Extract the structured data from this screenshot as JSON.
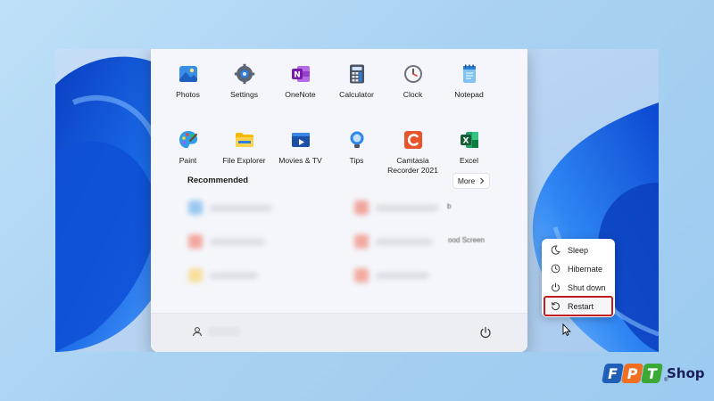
{
  "start_menu": {
    "apps": [
      {
        "label": "Photos",
        "icon": "photos-icon"
      },
      {
        "label": "Settings",
        "icon": "settings-icon"
      },
      {
        "label": "OneNote",
        "icon": "onenote-icon"
      },
      {
        "label": "Calculator",
        "icon": "calculator-icon"
      },
      {
        "label": "Clock",
        "icon": "clock-icon"
      },
      {
        "label": "Notepad",
        "icon": "notepad-icon"
      },
      {
        "label": "Paint",
        "icon": "paint-icon"
      },
      {
        "label": "File Explorer",
        "icon": "file-explorer-icon"
      },
      {
        "label": "Movies & TV",
        "icon": "movies-tv-icon"
      },
      {
        "label": "Tips",
        "icon": "tips-icon"
      },
      {
        "label": "Camtasia Recorder 2021",
        "icon": "camtasia-icon"
      },
      {
        "label": "Excel",
        "icon": "excel-icon"
      }
    ],
    "recommended_title": "Recommended",
    "more_label": "More",
    "peek_text": {
      "a": "b",
      "b": "ood Screen"
    }
  },
  "power_menu": {
    "items": [
      {
        "label": "Sleep",
        "icon": "sleep-icon"
      },
      {
        "label": "Hibernate",
        "icon": "hibernate-icon"
      },
      {
        "label": "Shut down",
        "icon": "shut-down-icon"
      },
      {
        "label": "Restart",
        "icon": "restart-icon"
      }
    ],
    "selected": "Restart"
  },
  "brand": {
    "letters": [
      "F",
      "P",
      "T"
    ],
    "name": "Shop",
    "reg": "®"
  },
  "colors": {
    "highlight": "#c21e22",
    "brand_blue": "#1f5fb8",
    "brand_orange": "#f26f21",
    "brand_green": "#3aa935"
  }
}
